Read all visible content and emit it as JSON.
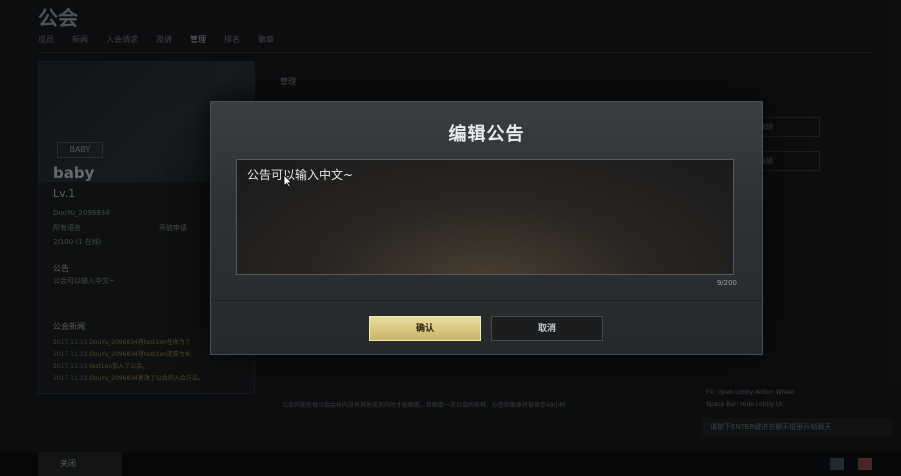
{
  "page": {
    "title": "公会"
  },
  "tabs": [
    "成员",
    "新闻",
    "入会请求",
    "邀请",
    "管理",
    "排名",
    "徽章"
  ],
  "left": {
    "badge": "BABY",
    "guild_name": "baby",
    "level": "Lv.1",
    "owner": "DouYu_2096834",
    "language": "所有语言",
    "open_apply": "开放申请",
    "members": "2/100 (1 在线)",
    "notice_header": "公告",
    "notice_text": "公会可以输入中文~",
    "news_header": "公会新闻",
    "news": [
      {
        "date": "2017.11.13",
        "text": "DouYu_2096834将test1en任命为了"
      },
      {
        "date": "2017.11.13",
        "text": "DouYu_2096834将test1en提拔为长"
      },
      {
        "date": "2017.11.13",
        "text": "test1en加入了公会。"
      },
      {
        "date": "2017.11.13",
        "text": "DouYu_2096834更改了公会的入会方法。"
      }
    ]
  },
  "right": {
    "header": "管理",
    "btn1": "编辑",
    "btn2": "编辑",
    "lobby_line1": "F4: Open Lobby Action Wheel",
    "lobby_line2": "Space Bar: Hide Lobby UI",
    "chat_hint": "请按下ENTER键进去聊天框里开始聊天",
    "footer_notice": "公会只能在每公会会长内没有其他成员的时才能解散，且解散一次公会的名称、标签和徽章将被保存48小时"
  },
  "bottom": {
    "close": "关闭"
  },
  "modal": {
    "title": "编辑公告",
    "text": "公告可以输入中文~",
    "counter": "9/200",
    "confirm": "确认",
    "cancel": "取消"
  }
}
